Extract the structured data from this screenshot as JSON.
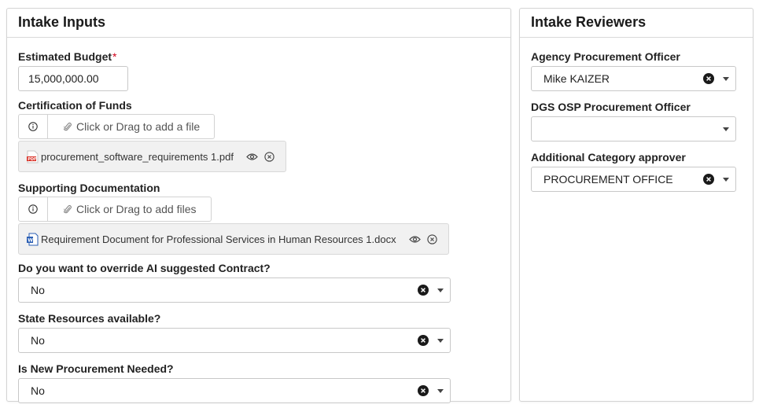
{
  "intake_inputs": {
    "title": "Intake Inputs",
    "estimated_budget": {
      "label": "Estimated Budget",
      "required_mark": "*",
      "value": "15,000,000.00"
    },
    "certification_of_funds": {
      "label": "Certification of Funds",
      "drop_text": "Click or Drag to add a file",
      "file_name": "procurement_software_requirements 1.pdf",
      "file_type": "pdf"
    },
    "supporting_documentation": {
      "label": "Supporting Documentation",
      "drop_text": "Click or Drag to add files",
      "file_name": "Requirement Document for Professional Services in Human Resources 1.docx",
      "file_type": "docx"
    },
    "override_contract": {
      "label": "Do you want to override AI suggested Contract?",
      "value": "No"
    },
    "state_resources": {
      "label": "State Resources available?",
      "value": "No"
    },
    "new_procurement": {
      "label": "Is New Procurement Needed?",
      "value": "No"
    }
  },
  "intake_reviewers": {
    "title": "Intake Reviewers",
    "agency_officer": {
      "label": "Agency Procurement Officer",
      "value": "Mike KAIZER"
    },
    "dgs_officer": {
      "label": "DGS OSP Procurement Officer",
      "value": ""
    },
    "category_approver": {
      "label": "Additional Category approver",
      "value": "PROCUREMENT OFFICE"
    }
  },
  "icons": {
    "info": "info-circle-icon",
    "paperclip": "paperclip-icon",
    "pdf": "pdf-file-icon",
    "word": "word-file-icon",
    "preview": "eye-icon",
    "remove": "remove-circle-icon",
    "clear": "clear-icon",
    "dropdown": "caret-down-icon"
  },
  "colors": {
    "required": "#d0021b",
    "pdf": "#d93025",
    "word": "#2b5fb4",
    "chip_bg": "#f1f1f1"
  }
}
